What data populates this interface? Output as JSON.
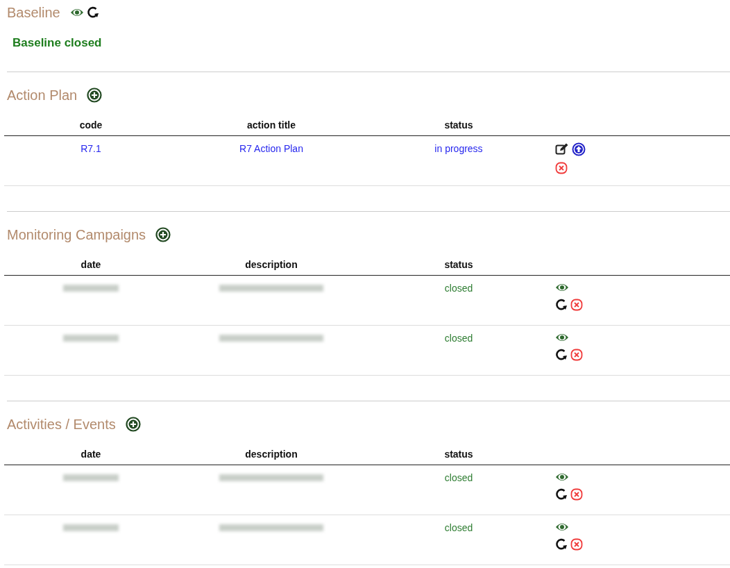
{
  "baseline": {
    "title": "Baseline",
    "actions": [
      {
        "kind": "view"
      },
      {
        "kind": "reload"
      }
    ],
    "status": "Baseline closed"
  },
  "sections": [
    {
      "title": "Action Plan",
      "columns": [
        "code",
        "action title",
        "status"
      ],
      "rows": [
        {
          "cells": [
            {
              "kind": "link",
              "text": "R7.1"
            },
            {
              "kind": "link",
              "text": "R7 Action Plan"
            },
            {
              "kind": "link",
              "text": "in progress"
            }
          ],
          "action_lines": [
            [
              {
                "kind": "edit"
              },
              {
                "kind": "upload"
              }
            ],
            [
              {
                "kind": "delete"
              }
            ]
          ]
        }
      ]
    },
    {
      "title": "Monitoring Campaigns",
      "columns": [
        "date",
        "description",
        "status"
      ],
      "rows": [
        {
          "cells": [
            {
              "kind": "redacted"
            },
            {
              "kind": "redacted"
            },
            {
              "kind": "status",
              "text": "closed"
            }
          ],
          "action_lines": [
            [
              {
                "kind": "view"
              }
            ],
            [
              {
                "kind": "reload"
              },
              {
                "kind": "delete"
              }
            ]
          ]
        },
        {
          "cells": [
            {
              "kind": "redacted"
            },
            {
              "kind": "redacted"
            },
            {
              "kind": "status",
              "text": "closed"
            }
          ],
          "action_lines": [
            [
              {
                "kind": "view"
              }
            ],
            [
              {
                "kind": "reload"
              },
              {
                "kind": "delete"
              }
            ]
          ]
        }
      ]
    },
    {
      "title": "Activities / Events",
      "columns": [
        "date",
        "description",
        "status"
      ],
      "rows": [
        {
          "cells": [
            {
              "kind": "redacted"
            },
            {
              "kind": "redacted"
            },
            {
              "kind": "status",
              "text": "closed"
            }
          ],
          "action_lines": [
            [
              {
                "kind": "view"
              }
            ],
            [
              {
                "kind": "reload"
              },
              {
                "kind": "delete"
              }
            ]
          ]
        },
        {
          "cells": [
            {
              "kind": "redacted"
            },
            {
              "kind": "redacted"
            },
            {
              "kind": "status",
              "text": "closed"
            }
          ],
          "action_lines": [
            [
              {
                "kind": "view"
              }
            ],
            [
              {
                "kind": "reload"
              },
              {
                "kind": "delete"
              }
            ]
          ]
        }
      ]
    }
  ]
}
